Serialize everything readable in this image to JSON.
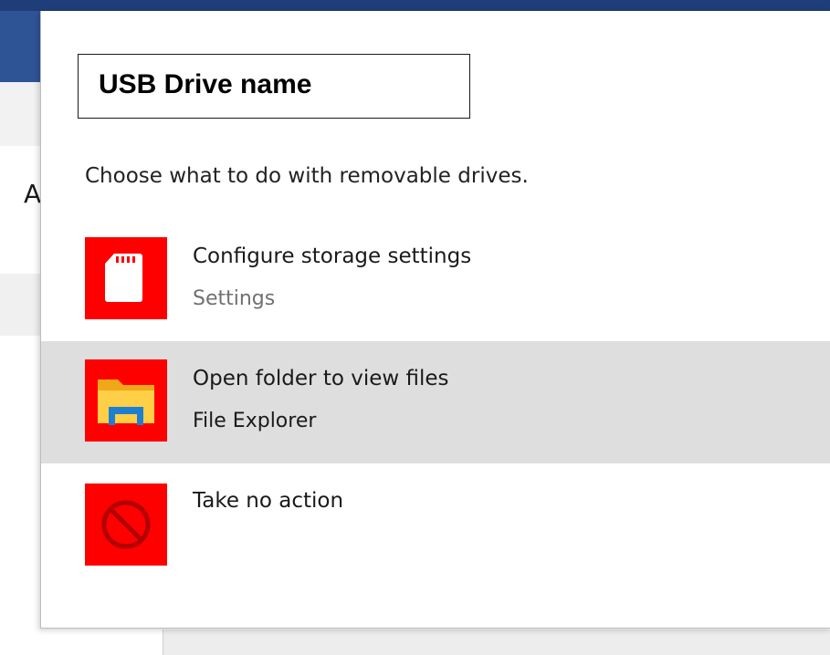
{
  "autoplay": {
    "drive_name": "USB Drive name",
    "prompt": "Choose what to do with removable drives.",
    "options": [
      {
        "title": "Configure storage settings",
        "subtitle": "Settings",
        "icon": "sd-card-icon",
        "selected": false
      },
      {
        "title": "Open folder to view files",
        "subtitle": "File Explorer",
        "icon": "folder-icon",
        "selected": true
      },
      {
        "title": "Take no action",
        "subtitle": "",
        "icon": "no-action-icon",
        "selected": false
      }
    ],
    "colors": {
      "icon_tile": "#ff0000",
      "selected_row": "#dedede"
    }
  },
  "background": {
    "partial_heading": "A"
  }
}
